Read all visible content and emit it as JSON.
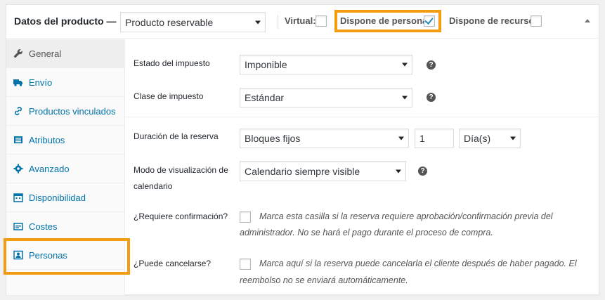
{
  "header": {
    "title": "Datos del producto —",
    "product_type": "Producto reservable",
    "virtual_label": "Virtual:",
    "persons_label": "Dispone de personas:",
    "resources_label": "Dispone de recursos:"
  },
  "sidebar": {
    "items": [
      {
        "label": "General",
        "icon": "wrench-icon"
      },
      {
        "label": "Envío",
        "icon": "truck-icon"
      },
      {
        "label": "Productos vinculados",
        "icon": "link-icon"
      },
      {
        "label": "Atributos",
        "icon": "list-icon"
      },
      {
        "label": "Avanzado",
        "icon": "gear-icon"
      },
      {
        "label": "Disponibilidad",
        "icon": "calendar-icon"
      },
      {
        "label": "Costes",
        "icon": "cost-icon"
      },
      {
        "label": "Personas",
        "icon": "person-icon"
      }
    ]
  },
  "fields": {
    "tax_status_label": "Estado del impuesto",
    "tax_status_value": "Imponible",
    "tax_class_label": "Clase de impuesto",
    "tax_class_value": "Estándar",
    "duration_label": "Duración de la reserva",
    "duration_type": "Bloques fijos",
    "duration_value": "1",
    "duration_unit": "Día(s)",
    "calendar_mode_label_1": "Modo de visualización de",
    "calendar_mode_label_2": "calendario",
    "calendar_mode_value": "Calendario siempre visible",
    "confirmation_label": "¿Requiere confirmación?",
    "confirmation_desc_1": "Marca esta casilla si la reserva requiere aprobación/confirmación previa del",
    "confirmation_desc_2": "administrador. No se hará el pago durante el proceso de compra.",
    "cancel_label": "¿Puede cancelarse?",
    "cancel_desc_1": "Marca aquí si la reserva puede cancelarla el cliente después de haber pagado. El",
    "cancel_desc_2": "reembolso no se enviará automáticamente."
  },
  "colors": {
    "highlight": "#f39c12",
    "link": "#0073aa",
    "check": "#1e8cbe"
  }
}
